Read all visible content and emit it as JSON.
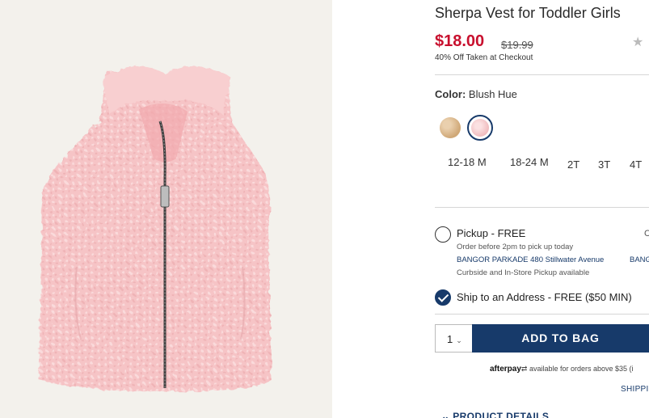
{
  "product": {
    "title": "Sherpa Vest for Toddler Girls",
    "sale_price": "$18.00",
    "original_price": "$19.99",
    "discount_note": "40% Off Taken at Checkout",
    "rating_icon": "star-icon"
  },
  "color": {
    "label": "Color:",
    "selected_name": "Blush Hue",
    "swatches": [
      {
        "name": "tan",
        "color": "#d8b58c",
        "selected": false
      },
      {
        "name": "blush",
        "color": "#f3c7c9",
        "selected": true
      }
    ]
  },
  "sizes": [
    "12-18 M",
    "18-24 M",
    "2T",
    "3T",
    "4T"
  ],
  "fulfillment": {
    "pickup": {
      "title": "Pickup - FREE",
      "note": "Order before 2pm to pick up today",
      "store": "BANGOR PARKADE 480 Stillwater Avenue",
      "store_overflow": "BANG",
      "availability": "Curbside and In-Store Pickup available",
      "edge_char": "C",
      "checked": false
    },
    "ship": {
      "title": "Ship to an Address - FREE ($50 MIN)",
      "checked": true
    }
  },
  "cart": {
    "quantity": "1",
    "add_label": "ADD TO BAG"
  },
  "afterpay": {
    "logo": "afterpay",
    "text": "available for orders above $35 (i"
  },
  "shipping_link": "SHIPPIN",
  "details_label": "PRODUCT DETAILS",
  "colors": {
    "accent": "#173a6a",
    "sale": "#c8102e",
    "image_bg": "#f3f1ec",
    "vest": "#f6c6c8"
  }
}
